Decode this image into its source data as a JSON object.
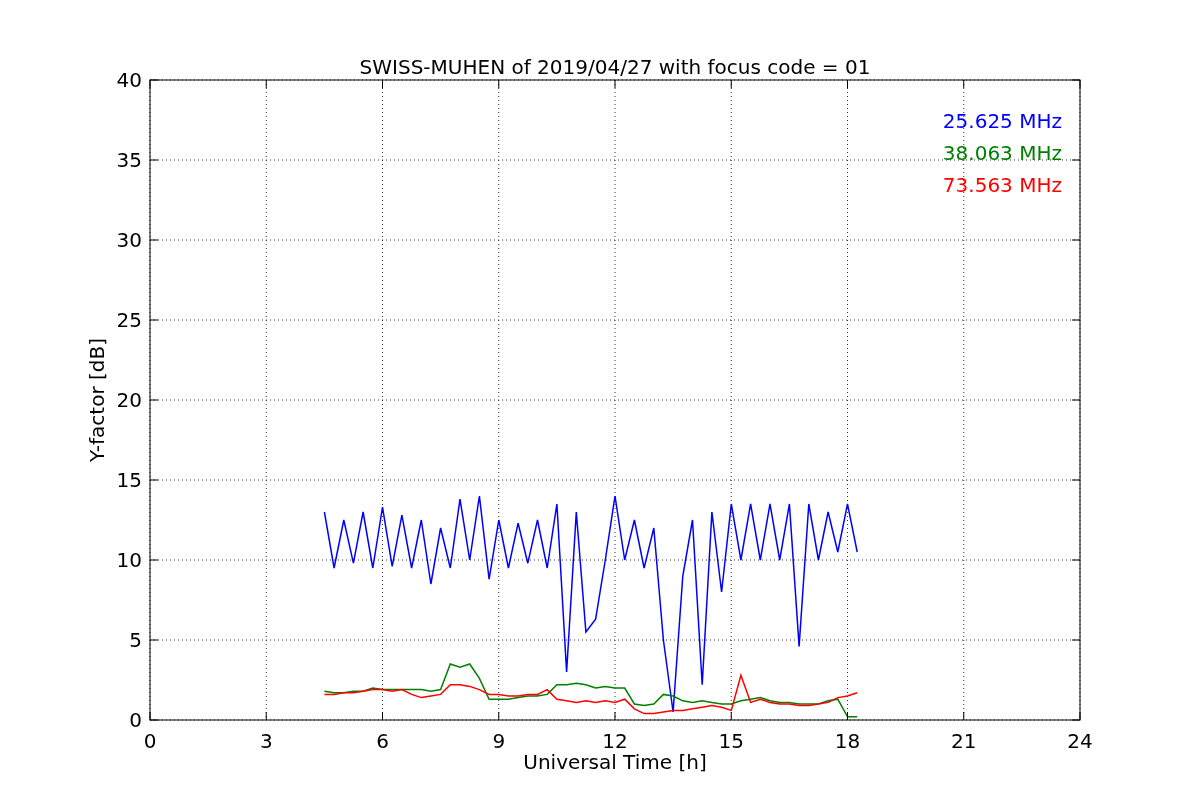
{
  "figure": {
    "chart_data": {
      "type": "line",
      "title": "SWISS-MUHEN of 2019/04/27 with focus code = 01",
      "xlabel": "Universal Time [h]",
      "ylabel": "Y-factor [dB]",
      "xlim": [
        0,
        24
      ],
      "ylim": [
        0,
        40
      ],
      "xticks": [
        0,
        3,
        6,
        9,
        12,
        15,
        18,
        21,
        24
      ],
      "yticks": [
        0,
        5,
        10,
        15,
        20,
        25,
        30,
        35,
        40
      ],
      "grid": true,
      "x": [
        4.5,
        4.75,
        5.0,
        5.25,
        5.5,
        5.75,
        6.0,
        6.25,
        6.5,
        6.75,
        7.0,
        7.25,
        7.5,
        7.75,
        8.0,
        8.25,
        8.5,
        8.75,
        9.0,
        9.25,
        9.5,
        9.75,
        10.0,
        10.25,
        10.5,
        10.75,
        11.0,
        11.25,
        11.5,
        11.75,
        12.0,
        12.25,
        12.5,
        12.75,
        13.0,
        13.25,
        13.5,
        13.75,
        14.0,
        14.25,
        14.5,
        14.75,
        15.0,
        15.25,
        15.5,
        15.75,
        16.0,
        16.25,
        16.5,
        16.75,
        17.0,
        17.25,
        17.5,
        17.75,
        18.0,
        18.25
      ],
      "series": [
        {
          "name": "25.625 MHz",
          "color": "#0000ff",
          "values": [
            13,
            9.5,
            12.5,
            9.8,
            13,
            9.5,
            13.3,
            9.6,
            12.8,
            9.5,
            12.5,
            8.5,
            12,
            9.5,
            13.8,
            10,
            14,
            8.8,
            12.5,
            9.5,
            12.3,
            9.8,
            12.5,
            9.5,
            13.5,
            3,
            13,
            5.5,
            6.3,
            10,
            14,
            10,
            12.5,
            9.5,
            12,
            5,
            0.5,
            9,
            12.5,
            2.2,
            13,
            8,
            13.5,
            10,
            13.5,
            10,
            13.5,
            10,
            13.5,
            4.6,
            13.5,
            10,
            13,
            10.5,
            13.5,
            10.5
          ]
        },
        {
          "name": "38.063 MHz",
          "color": "#008000",
          "values": [
            1.8,
            1.7,
            1.7,
            1.8,
            1.8,
            2.0,
            1.9,
            1.9,
            1.9,
            1.9,
            1.9,
            1.8,
            1.9,
            3.5,
            3.3,
            3.5,
            2.6,
            1.3,
            1.3,
            1.3,
            1.4,
            1.5,
            1.5,
            1.6,
            2.2,
            2.2,
            2.3,
            2.2,
            2.0,
            2.1,
            2.0,
            2.0,
            1.0,
            0.9,
            1.0,
            1.6,
            1.5,
            1.2,
            1.1,
            1.2,
            1.1,
            1.0,
            1.0,
            1.2,
            1.3,
            1.4,
            1.2,
            1.1,
            1.1,
            1.0,
            1.0,
            1.0,
            1.2,
            1.3,
            0.2,
            0.2
          ]
        },
        {
          "name": "73.563 MHz",
          "color": "#ff0000",
          "values": [
            1.6,
            1.6,
            1.7,
            1.7,
            1.8,
            1.9,
            1.9,
            1.8,
            1.9,
            1.6,
            1.4,
            1.5,
            1.6,
            2.2,
            2.2,
            2.1,
            1.9,
            1.6,
            1.6,
            1.5,
            1.5,
            1.6,
            1.6,
            1.9,
            1.3,
            1.2,
            1.1,
            1.2,
            1.1,
            1.2,
            1.1,
            1.3,
            0.7,
            0.4,
            0.4,
            0.5,
            0.6,
            0.6,
            0.7,
            0.8,
            0.9,
            0.8,
            0.6,
            2.8,
            1.1,
            1.3,
            1.1,
            1.0,
            1.0,
            0.9,
            0.9,
            1.0,
            1.1,
            1.4,
            1.5,
            1.7
          ]
        }
      ]
    }
  }
}
